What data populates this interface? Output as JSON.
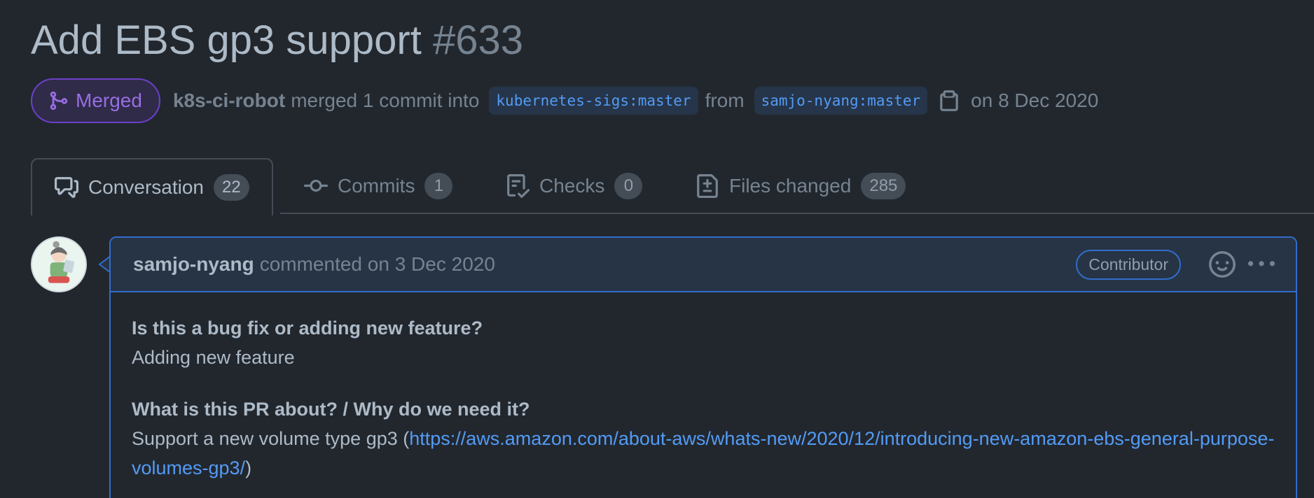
{
  "pr": {
    "title": "Add EBS gp3 support",
    "number": "#633"
  },
  "meta": {
    "state": "Merged",
    "author": "k8s-ci-robot",
    "action": "merged 1 commit into",
    "base_branch": "kubernetes-sigs:master",
    "from_label": "from",
    "head_branch": "samjo-nyang:master",
    "date_text": "on 8 Dec 2020"
  },
  "tabs": [
    {
      "label": "Conversation",
      "count": "22",
      "icon": "comment-discussion-icon"
    },
    {
      "label": "Commits",
      "count": "1",
      "icon": "git-commit-icon"
    },
    {
      "label": "Checks",
      "count": "0",
      "icon": "checklist-icon"
    },
    {
      "label": "Files changed",
      "count": "285",
      "icon": "file-diff-icon"
    }
  ],
  "comment": {
    "author": "samjo-nyang",
    "action_date": "commented on 3 Dec 2020",
    "role": "Contributor",
    "q1": "Is this a bug fix or adding new feature?",
    "a1": "Adding new feature",
    "q2": "What is this PR about? / Why do we need it?",
    "a2_prefix": "Support a new volume type gp3 (",
    "a2_link": "https://aws.amazon.com/about-aws/whats-new/2020/12/introducing-new-amazon-ebs-general-purpose-volumes-gp3/",
    "a2_suffix": ")"
  },
  "colors": {
    "background": "#22272e",
    "merged": "#986ee2",
    "link": "#539bf5",
    "accent_border": "#316dca"
  }
}
